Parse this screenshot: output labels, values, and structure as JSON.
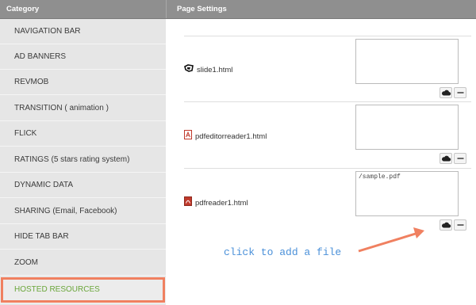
{
  "header": {
    "category_title": "Category",
    "settings_title": "Page Settings"
  },
  "sidebar": {
    "items": [
      {
        "label": "NAVIGATION BAR"
      },
      {
        "label": "AD BANNERS"
      },
      {
        "label": "REVMOB"
      },
      {
        "label": "TRANSITION ( animation )"
      },
      {
        "label": "FLICK"
      },
      {
        "label": "RATINGS (5 stars rating system)"
      },
      {
        "label": "DYNAMIC DATA"
      },
      {
        "label": "SHARING (Email, Facebook)"
      },
      {
        "label": "HIDE TAB BAR"
      },
      {
        "label": "ZOOM"
      },
      {
        "label": "HOSTED RESOURCES",
        "active": true
      }
    ]
  },
  "files": [
    {
      "name": "slide1.html",
      "icon": "slideshow-icon",
      "value": ""
    },
    {
      "name": "pdfeditorreader1.html",
      "icon": "pdf-editor-icon",
      "value": ""
    },
    {
      "name": "pdfreader1.html",
      "icon": "pdf-icon",
      "value": "/sample.pdf"
    }
  ],
  "annotation": {
    "text": "click to add a file",
    "color": "#4a90d9",
    "arrow_color": "#f08060"
  },
  "colors": {
    "header_bg": "#8f8f8f",
    "sidebar_bg": "#e6e6e6",
    "active_text": "#6aa63a",
    "active_outline": "#f08060"
  }
}
